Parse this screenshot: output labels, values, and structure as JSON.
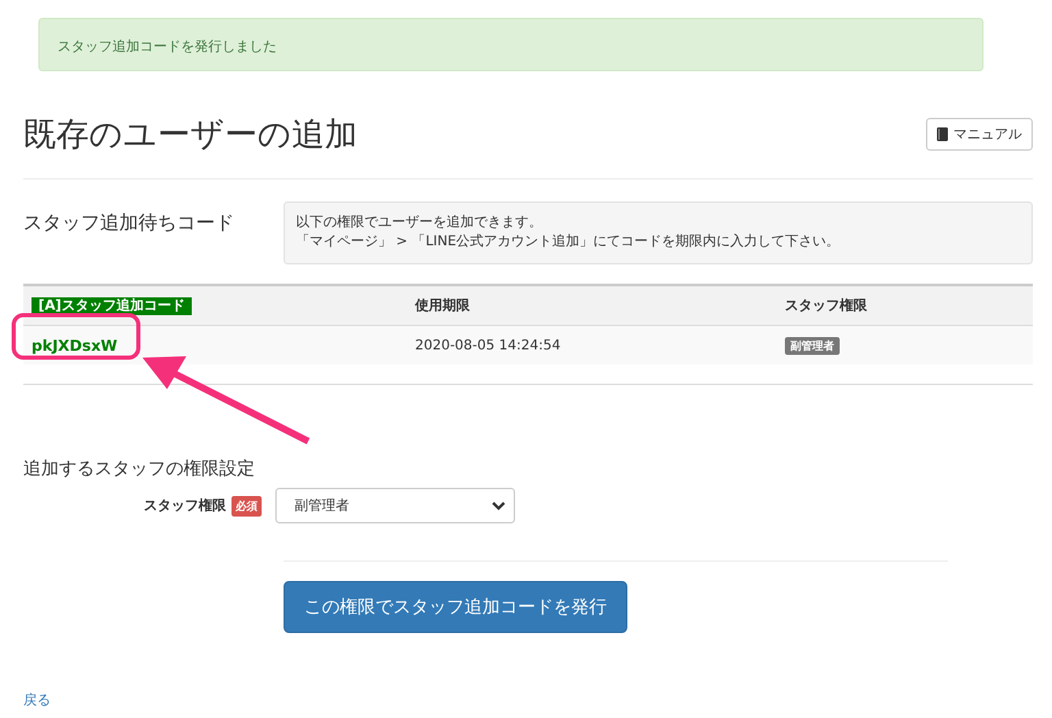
{
  "alert": {
    "text": "スタッフ追加コードを発行しました"
  },
  "title": "既存のユーザーの追加",
  "manual_button": {
    "label": "マニュアル"
  },
  "pending": {
    "label": "スタッフ追加待ちコード",
    "info": [
      "以下の権限でユーザーを追加できます。",
      "「マイページ」 > 「LINE公式アカウント追加」にてコードを期限内に入力して下さい。"
    ]
  },
  "table": {
    "columns": [
      "[A]スタッフ追加コード",
      "使用期限",
      "スタッフ権限"
    ],
    "rows": [
      {
        "code": "pkJXDsxW",
        "expires": "2020-08-05 14:24:54",
        "role": "副管理者"
      }
    ]
  },
  "settings": {
    "heading": "追加するスタッフの権限設定",
    "field_label": "スタッフ権限",
    "required_badge": "必須",
    "select_value": "副管理者"
  },
  "submit_button": "この権限でスタッフ追加コードを発行",
  "back_link": "戻る"
}
